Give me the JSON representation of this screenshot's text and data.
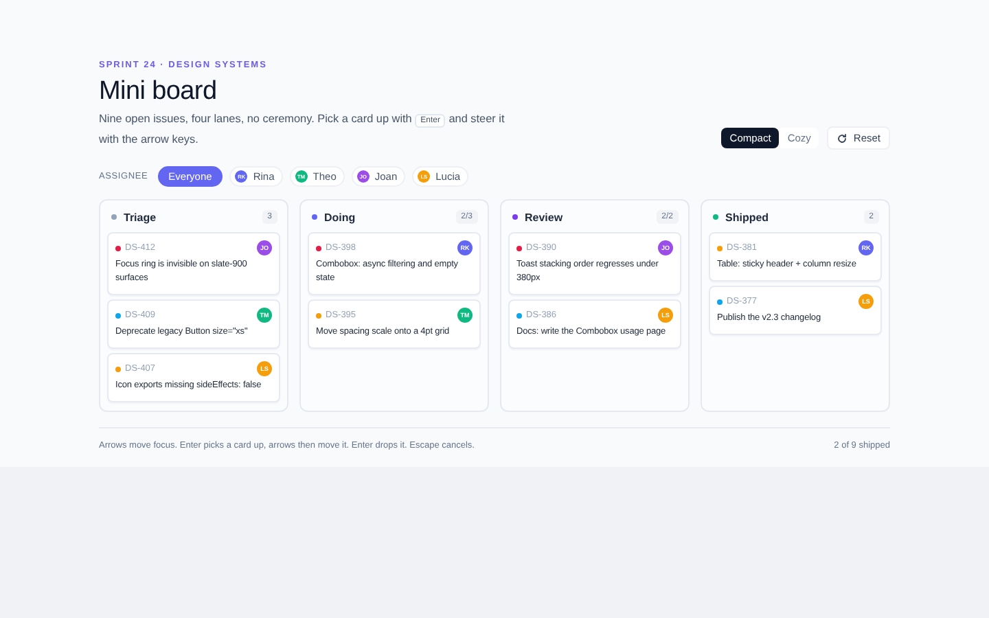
{
  "eyebrow": "SPRINT 24 · DESIGN SYSTEMS",
  "title": "Mini board",
  "description": {
    "before": "Nine open issues, four lanes, no ceremony. Pick a card up with",
    "key": "Enter",
    "after": "and steer it with the arrow keys."
  },
  "density": [
    {
      "label": "Compact",
      "selected": true
    },
    {
      "label": "Cozy",
      "selected": false
    }
  ],
  "reset_button": "Reset",
  "assignee_filter": {
    "label": "ASSIGNEE",
    "options": [
      {
        "label": "Everyone",
        "selected": true
      },
      {
        "label": "Rina",
        "initials": "RK",
        "color": "#6366f1",
        "selected": false
      },
      {
        "label": "Theo",
        "initials": "TM",
        "color": "#10b981",
        "selected": false
      },
      {
        "label": "Joan",
        "initials": "JO",
        "color": "#9b4de8",
        "selected": false
      },
      {
        "label": "Lucia",
        "initials": "LS",
        "color": "#f59e0b",
        "selected": false
      }
    ]
  },
  "lanes": [
    {
      "name": "Triage",
      "color": "#94a3b8",
      "count": "3",
      "cards": [
        {
          "id": "DS-412",
          "color": "#e11d48",
          "title": "Focus ring is invisible on slate-900 surfaces",
          "avatar": {
            "initials": "JO",
            "color": "#9b4de8"
          }
        },
        {
          "id": "DS-409",
          "color": "#0ea5e9",
          "title": "Deprecate legacy Button size=\"xs\"",
          "avatar": {
            "initials": "TM",
            "color": "#10b981"
          }
        },
        {
          "id": "DS-407",
          "color": "#f59e0b",
          "title": "Icon exports missing sideEffects: false",
          "avatar": {
            "initials": "LS",
            "color": "#f59e0b"
          }
        }
      ]
    },
    {
      "name": "Doing",
      "color": "#6366f1",
      "count": "2/3",
      "cards": [
        {
          "id": "DS-398",
          "color": "#e11d48",
          "title": "Combobox: async filtering and empty state",
          "avatar": {
            "initials": "RK",
            "color": "#6366f1"
          }
        },
        {
          "id": "DS-395",
          "color": "#f59e0b",
          "title": "Move spacing scale onto a 4pt grid",
          "avatar": {
            "initials": "TM",
            "color": "#10b981"
          }
        }
      ]
    },
    {
      "name": "Review",
      "color": "#7c3aed",
      "count": "2/2",
      "cards": [
        {
          "id": "DS-390",
          "color": "#e11d48",
          "title": "Toast stacking order regresses under 380px",
          "avatar": {
            "initials": "JO",
            "color": "#9b4de8"
          }
        },
        {
          "id": "DS-386",
          "color": "#0ea5e9",
          "title": "Docs: write the Combobox usage page",
          "avatar": {
            "initials": "LS",
            "color": "#f59e0b"
          }
        }
      ]
    },
    {
      "name": "Shipped",
      "color": "#10b981",
      "count": "2",
      "cards": [
        {
          "id": "DS-381",
          "color": "#f59e0b",
          "title": "Table: sticky header + column resize",
          "avatar": {
            "initials": "RK",
            "color": "#6366f1"
          }
        },
        {
          "id": "DS-377",
          "color": "#0ea5e9",
          "title": "Publish the v2.3 changelog",
          "avatar": {
            "initials": "LS",
            "color": "#f59e0b"
          }
        }
      ]
    }
  ],
  "footer": {
    "hint": "Arrows move focus. Enter picks a card up, arrows then move it. Enter drops it. Escape cancels.",
    "status": "2 of 9 shipped"
  }
}
